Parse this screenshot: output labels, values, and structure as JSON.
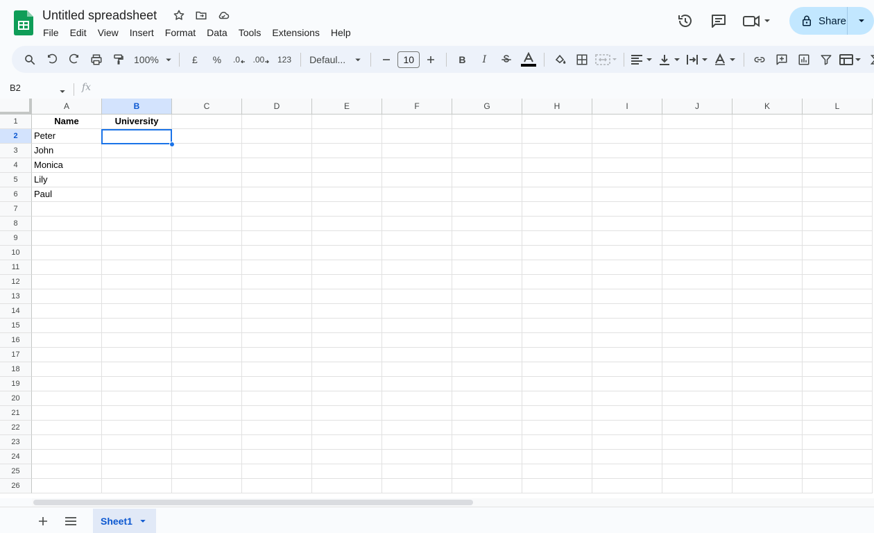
{
  "title_bar": {
    "doc_title": "Untitled spreadsheet",
    "menu": [
      "File",
      "Edit",
      "View",
      "Insert",
      "Format",
      "Data",
      "Tools",
      "Extensions",
      "Help"
    ],
    "share_label": "Share"
  },
  "toolbar": {
    "zoom": "100%",
    "currency": "£",
    "percent": "%",
    "decrease_decimal": ".0",
    "increase_decimal": ".00",
    "number_format": "123",
    "font_name": "Defaul...",
    "font_size": "10",
    "bold": "B",
    "italic": "I"
  },
  "formula_bar": {
    "cell_ref": "B2",
    "fx_label": "fx"
  },
  "grid": {
    "columns": [
      "A",
      "B",
      "C",
      "D",
      "E",
      "F",
      "G",
      "H",
      "I",
      "J",
      "K",
      "L"
    ],
    "rows": [
      "1",
      "2",
      "3",
      "4",
      "5",
      "6",
      "7",
      "8",
      "9",
      "10",
      "11",
      "12",
      "13",
      "14",
      "15",
      "16",
      "17",
      "18",
      "19",
      "20",
      "21",
      "22",
      "23",
      "24",
      "25",
      "26"
    ],
    "active_column": "B",
    "active_row": "2",
    "cells": {
      "A1": "Name",
      "B1": "University",
      "A2": "Peter",
      "A3": "John",
      "A4": "Monica",
      "A5": "Lily",
      "A6": "Paul"
    }
  },
  "sheets": {
    "tabs": [
      "Sheet1"
    ]
  },
  "colors": {
    "accent": "#0b57d0",
    "selection": "#1a73e8",
    "share_bg": "#c2e7ff",
    "sheets_green": "#0f9d58"
  }
}
